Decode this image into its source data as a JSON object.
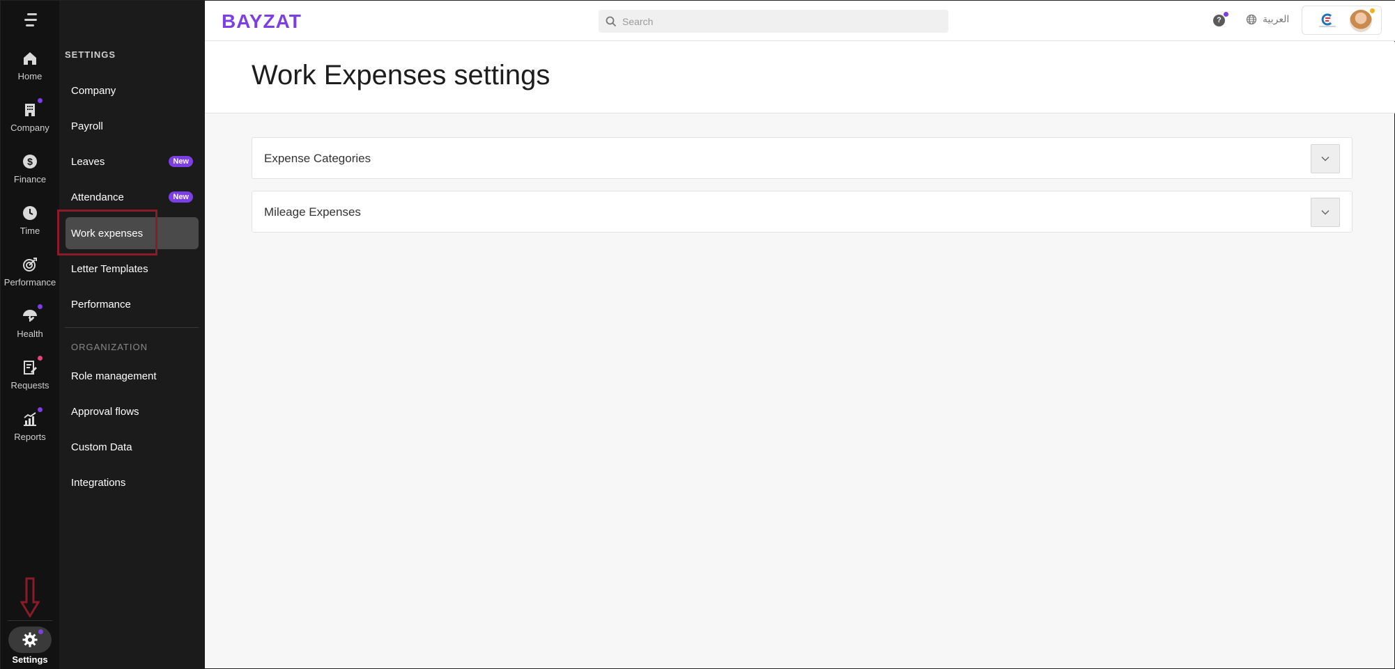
{
  "rail": {
    "items": [
      {
        "label": "Home",
        "icon": "home-icon"
      },
      {
        "label": "Company",
        "icon": "building-icon"
      },
      {
        "label": "Finance",
        "icon": "dollar-icon"
      },
      {
        "label": "Time",
        "icon": "clock-icon"
      },
      {
        "label": "Performance",
        "icon": "target-icon"
      },
      {
        "label": "Health",
        "icon": "umbrella-heart-icon"
      },
      {
        "label": "Requests",
        "icon": "request-doc-icon"
      },
      {
        "label": "Reports",
        "icon": "chart-icon"
      }
    ],
    "settings_label": "Settings"
  },
  "sidebar": {
    "section_settings": "SETTINGS",
    "items": [
      {
        "label": "Company"
      },
      {
        "label": "Payroll"
      },
      {
        "label": "Leaves",
        "badge": "New"
      },
      {
        "label": "Attendance",
        "badge": "New"
      },
      {
        "label": "Work expenses"
      },
      {
        "label": "Letter Templates"
      },
      {
        "label": "Performance"
      }
    ],
    "section_org": "ORGANIZATION",
    "org_items": [
      {
        "label": "Role management"
      },
      {
        "label": "Approval flows"
      },
      {
        "label": "Custom Data"
      },
      {
        "label": "Integrations"
      }
    ]
  },
  "topbar": {
    "logo": "BAYZAT",
    "search_placeholder": "Search",
    "help": "?",
    "language": "العربية"
  },
  "page": {
    "title": "Work Expenses settings",
    "accordions": [
      {
        "title": "Expense Categories"
      },
      {
        "title": "Mileage Expenses"
      }
    ]
  },
  "colors": {
    "brand": "#7b3fe4",
    "annotation": "#8b1a2b",
    "dot_purple": "#7b3fe4",
    "dot_pink": "#e0457b",
    "dot_yellow": "#f2b01e"
  }
}
